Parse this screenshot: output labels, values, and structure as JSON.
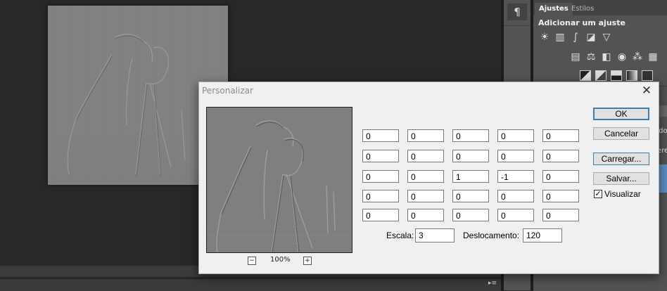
{
  "panel": {
    "tab_active": "Ajustes",
    "tab_inactive": "Estilos",
    "heading": "Adicionar um ajuste",
    "paragraph_icon": "¶",
    "side_text_1": "ado",
    "side_text_2": "ere"
  },
  "dialog": {
    "title": "Personalizar",
    "close_glyph": "✕",
    "zoom_level": "100%",
    "zoom_minus": "−",
    "zoom_plus": "+",
    "matrix": [
      [
        "0",
        "0",
        "0",
        "0",
        "0"
      ],
      [
        "0",
        "0",
        "0",
        "0",
        "0"
      ],
      [
        "0",
        "0",
        "1",
        "-1",
        "0"
      ],
      [
        "0",
        "0",
        "0",
        "0",
        "0"
      ],
      [
        "0",
        "0",
        "0",
        "0",
        "0"
      ]
    ],
    "scale_label": "Escala:",
    "scale_value": "3",
    "offset_label": "Deslocamento:",
    "offset_value": "120",
    "buttons": {
      "ok": "OK",
      "cancel": "Cancelar",
      "load": "Carregar...",
      "save": "Salvar..."
    },
    "preview_checkbox": {
      "label": "Visualizar",
      "checked": true,
      "check_glyph": "✓"
    }
  },
  "status": {
    "menu_glyph": "▸≡"
  }
}
